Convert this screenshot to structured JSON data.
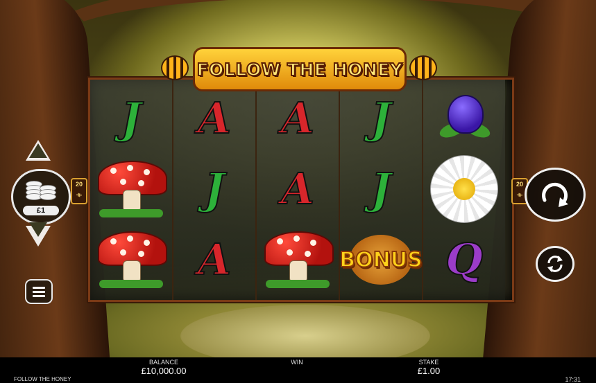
{
  "game": {
    "logo_text": "FOLLOW THE HONEY",
    "name": "FOLLOW THE HONEY"
  },
  "reels": [
    [
      "J",
      "mushroom",
      "mushroom"
    ],
    [
      "A",
      "J",
      "A"
    ],
    [
      "A",
      "A",
      "mushroom"
    ],
    [
      "J",
      "J",
      "bonus"
    ],
    [
      "tulip",
      "daisy",
      "Q"
    ]
  ],
  "symbols": {
    "bonus_label": "BONUS"
  },
  "paylines": {
    "left": {
      "line1": "20",
      "line2": "⟛"
    },
    "right": {
      "line1": "20",
      "line2": "⟛"
    }
  },
  "controls": {
    "coin_value": "£1",
    "spin_icon": "spin-arrow-icon",
    "autoplay_icon": "autoplay-icon",
    "menu_icon": "hamburger-menu-icon",
    "bet_up_icon": "triangle-up-icon",
    "bet_down_icon": "triangle-down-icon"
  },
  "status_bar": {
    "balance_label": "BALANCE",
    "balance_value": "£10,000.00",
    "win_label": "WIN",
    "win_value": "",
    "stake_label": "STAKE",
    "stake_value": "£1.00",
    "clock": "17:31"
  },
  "colors": {
    "J": "#2db13a",
    "A": "#d8262b",
    "Q": "#9b3cc8",
    "logo": "#ffd23a",
    "frame": "#7a3a16"
  }
}
